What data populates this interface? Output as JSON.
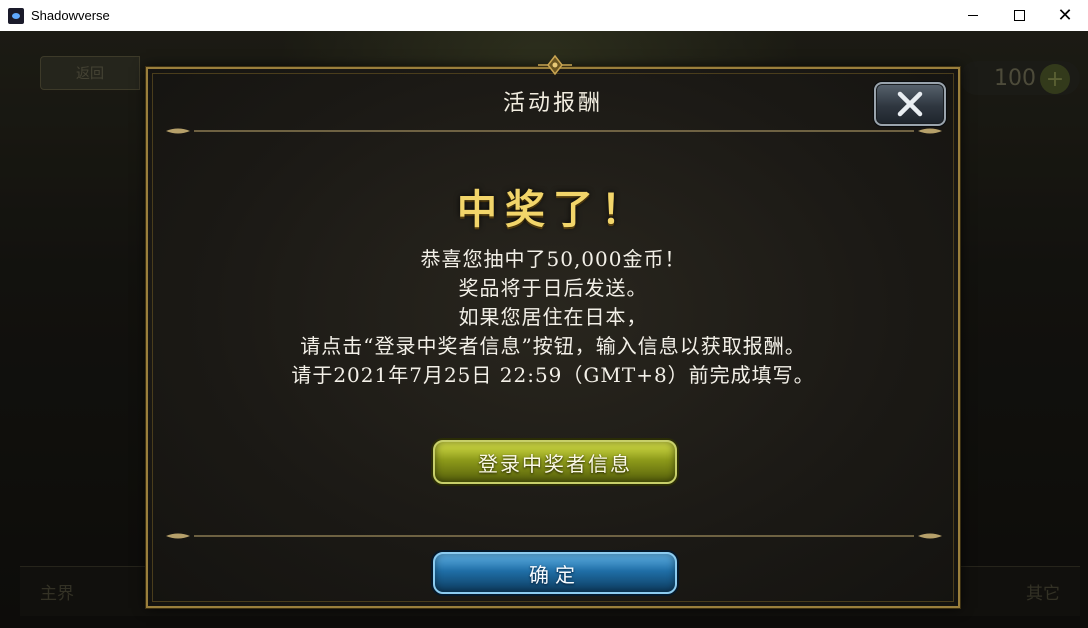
{
  "window": {
    "title": "Shadowverse",
    "close_glyph": "✕"
  },
  "background": {
    "back_label": "返回",
    "coins": "100",
    "coin_plus": "+",
    "bottom_left": "主界",
    "bottom_right": "其它"
  },
  "dialog": {
    "title": "活动报酬",
    "headline": "中奖了！",
    "message_lines": [
      "恭喜您抽中了50,000金币！",
      "奖品将于日后发送。",
      "如果您居住在日本，",
      "请点击“登录中奖者信息”按钮，输入信息以获取报酬。",
      "请于2021年7月25日 22:59（GMT+8）前完成填写。"
    ],
    "register_button": "登录中奖者信息",
    "confirm_button": "确定",
    "close_icon": "close-icon"
  },
  "colors": {
    "headline": "#f2d56a",
    "register_button": "#8d9a1a",
    "confirm_button": "#1f6ea6",
    "frame_gold": "#9a7f3c"
  }
}
